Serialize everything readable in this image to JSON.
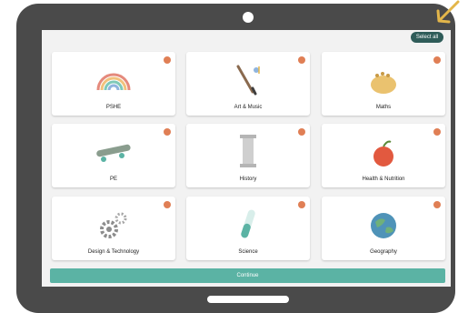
{
  "header": {
    "select_all_label": "Select all"
  },
  "subjects": [
    {
      "label": "PSHE",
      "icon": "rainbow-icon"
    },
    {
      "label": "Art & Music",
      "icon": "paintbrush-icon"
    },
    {
      "label": "Maths",
      "icon": "abacus-icon"
    },
    {
      "label": "PE",
      "icon": "skateboard-icon"
    },
    {
      "label": "History",
      "icon": "column-icon"
    },
    {
      "label": "Health & Nutrition",
      "icon": "apple-icon"
    },
    {
      "label": "Design & Technology",
      "icon": "gears-icon"
    },
    {
      "label": "Science",
      "icon": "test-tube-icon"
    },
    {
      "label": "Geography",
      "icon": "globe-icon"
    }
  ],
  "footer": {
    "continue_label": "Continue"
  },
  "colors": {
    "accent": "#5bb3a4",
    "select_all": "#2f5c59",
    "check": "#e07f55",
    "device": "#4a4a4a"
  }
}
